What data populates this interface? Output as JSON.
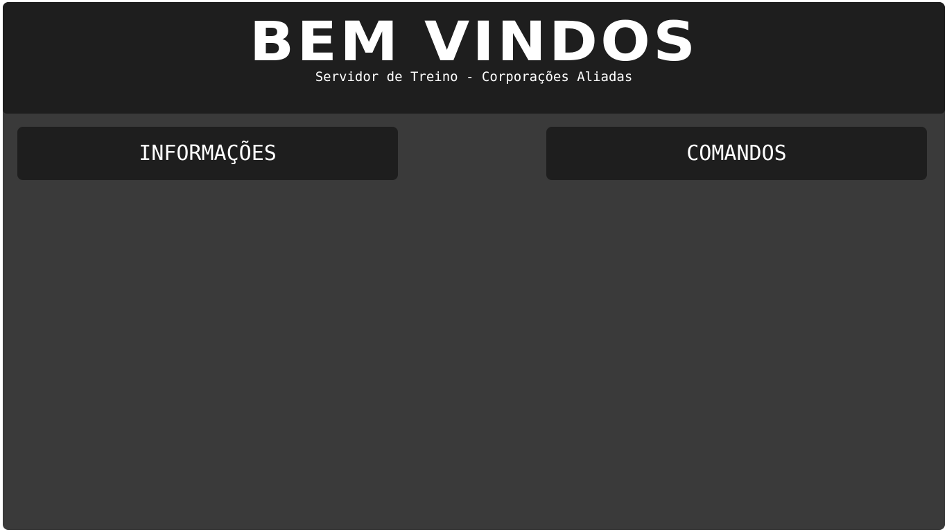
{
  "header": {
    "title": "BEM VINDOS",
    "subtitle": "Servidor de Treino - Corporações Aliadas"
  },
  "nav": {
    "info_label": "INFORMAÇÕES",
    "commands_label": "COMANDOS"
  },
  "colors": {
    "page_background": "#3a3a3a",
    "panel_background": "#1e1e1e",
    "text": "#ffffff"
  }
}
